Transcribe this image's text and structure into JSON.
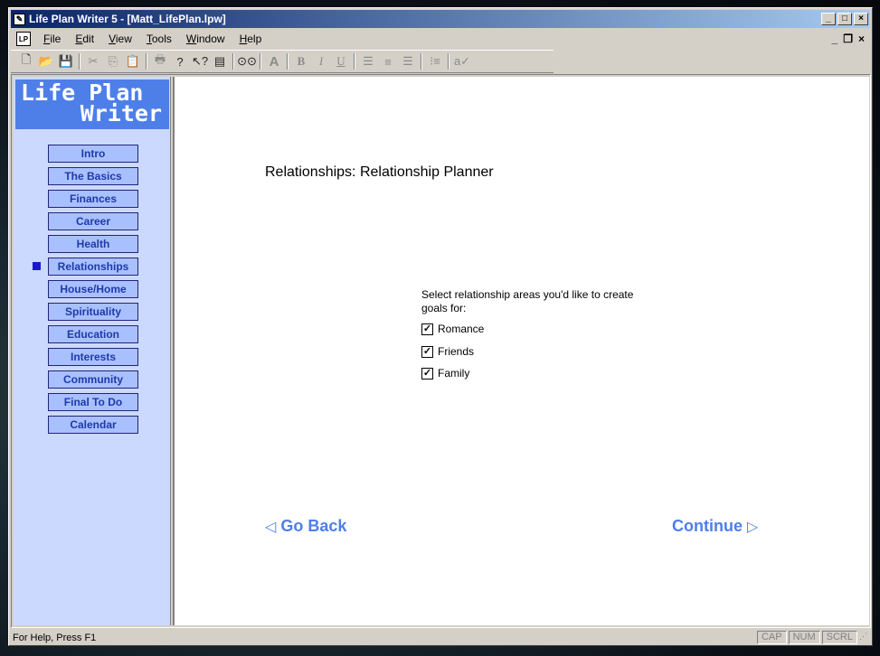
{
  "window": {
    "title": "Life Plan Writer 5 - [Matt_LifePlan.lpw]"
  },
  "menu": {
    "items": [
      {
        "label": "File"
      },
      {
        "label": "Edit"
      },
      {
        "label": "View"
      },
      {
        "label": "Tools"
      },
      {
        "label": "Window"
      },
      {
        "label": "Help"
      }
    ]
  },
  "toolbar": {
    "icons": [
      "new-icon",
      "open-icon",
      "save-icon",
      "cut-icon",
      "copy-icon",
      "paste-icon",
      "print-icon",
      "help-icon",
      "context-help-icon",
      "notes-icon",
      "find-icon",
      "font-icon",
      "bold-icon",
      "italic-icon",
      "underline-icon",
      "align-left-icon",
      "align-center-icon",
      "align-right-icon",
      "bullets-icon",
      "spellcheck-icon"
    ]
  },
  "sidebar": {
    "logo_line1": "Life Plan",
    "logo_line2": "Writer",
    "items": [
      {
        "label": "Intro"
      },
      {
        "label": "The Basics"
      },
      {
        "label": "Finances"
      },
      {
        "label": "Career"
      },
      {
        "label": "Health"
      },
      {
        "label": "Relationships"
      },
      {
        "label": "House/Home"
      },
      {
        "label": "Spirituality"
      },
      {
        "label": "Education"
      },
      {
        "label": "Interests"
      },
      {
        "label": "Community"
      },
      {
        "label": "Final To Do"
      },
      {
        "label": "Calendar"
      }
    ],
    "active_index": 5
  },
  "content": {
    "title": "Relationships: Relationship Planner",
    "prompt": "Select relationship areas you'd like to create goals for:",
    "options": [
      {
        "label": "Romance",
        "checked": true
      },
      {
        "label": "Friends",
        "checked": true
      },
      {
        "label": "Family",
        "checked": true
      }
    ],
    "back_label": "Go Back",
    "continue_label": "Continue"
  },
  "status": {
    "text": "For Help, Press F1",
    "panels": [
      "CAP",
      "NUM",
      "SCRL"
    ]
  },
  "colors": {
    "accent": "#4e7fe8",
    "sidebar_bg": "#ccd9ff",
    "nav_button": "#a9c0ff",
    "active_marker": "#1a1acd"
  }
}
